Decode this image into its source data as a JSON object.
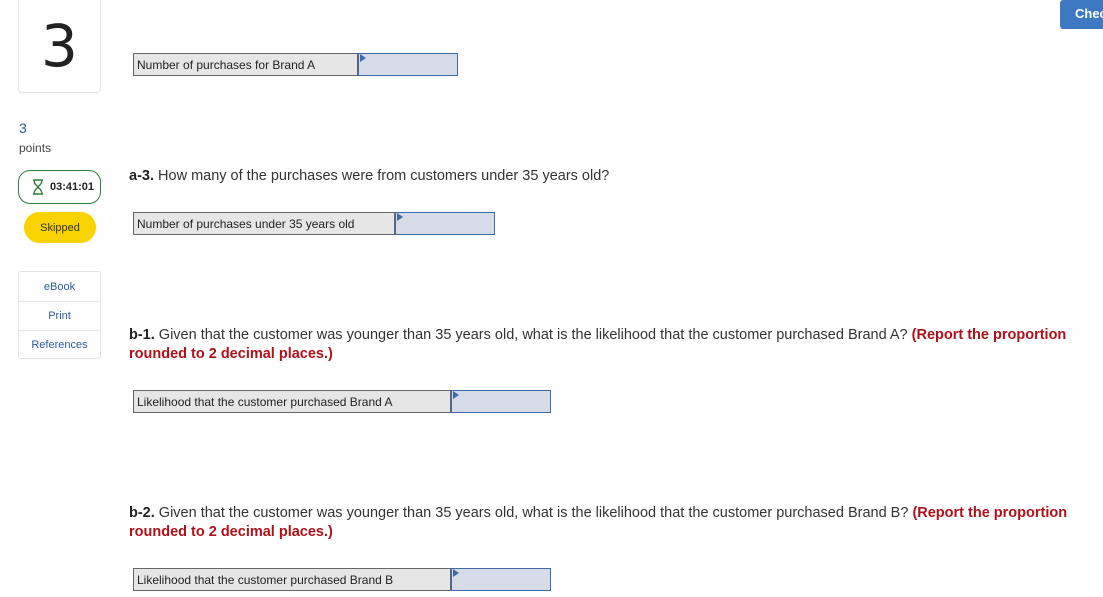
{
  "question": {
    "number": "3",
    "points_value": "3",
    "points_label": "points",
    "timer": "03:41:01",
    "status": "Skipped"
  },
  "resources": {
    "items": [
      "eBook",
      "Print",
      "References"
    ]
  },
  "header": {
    "check_label": "Check my work"
  },
  "answers": {
    "brand_a": {
      "label": "Number of purchases for Brand A",
      "value": ""
    },
    "under_35": {
      "label": "Number of purchases under 35 years old",
      "value": ""
    },
    "likelihood_a": {
      "label": "Likelihood that the customer purchased Brand A",
      "value": ""
    },
    "likelihood_b": {
      "label": "Likelihood that the customer purchased Brand B",
      "value": ""
    }
  },
  "questions": {
    "a3": {
      "id": "a-3.",
      "text": " How many of the purchases were from customers under 35 years old?"
    },
    "b1": {
      "id": "b-1.",
      "text": " Given that the customer was younger than 35 years old, what is the likelihood that the customer purchased Brand A? ",
      "instruction": "(Report the proportion rounded to 2 decimal places.)"
    },
    "b2": {
      "id": "b-2.",
      "text": " Given that the customer was younger than 35 years old, what is the likelihood that the customer purchased Brand B? ",
      "instruction": "(Report the proportion rounded to 2 decimal places.)"
    }
  },
  "colors": {
    "accent_blue": "#3d78c2",
    "instruction_red": "#b0101a",
    "skipped_yellow": "#f8d300",
    "timer_green": "#2f7d3a"
  },
  "icons": {
    "timer": "hourglass-icon",
    "answer_marker": "flag-triangle-icon"
  }
}
